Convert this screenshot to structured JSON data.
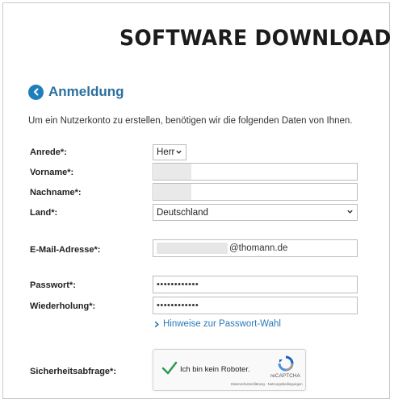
{
  "header": {
    "title": "SOFTWARE DOWNLOAD"
  },
  "section": {
    "title": "Anmeldung",
    "intro": "Um ein Nutzerkonto zu erstellen, benötigen wir die folgenden Daten von Ihnen."
  },
  "form": {
    "salutation": {
      "label": "Anrede*:",
      "value": "Herr"
    },
    "firstname": {
      "label": "Vorname*:",
      "value": ""
    },
    "lastname": {
      "label": "Nachname*:",
      "value": ""
    },
    "country": {
      "label": "Land*:",
      "value": "Deutschland"
    },
    "email": {
      "label": "E-Mail-Adresse*:",
      "domain": "@thomann.de"
    },
    "password": {
      "label": "Passwort*:",
      "value": "••••••••••••"
    },
    "repeat": {
      "label": "Wiederholung*:",
      "value": "••••••••••••"
    },
    "password_hint": "Hinweise zur Passwort-Wahl",
    "security": {
      "label": "Sicherheitsabfrage*:"
    }
  },
  "captcha": {
    "label": "Ich bin kein Roboter.",
    "brand": "reCAPTCHA",
    "legal": "Datenschutzerklärung - Nutzungsbedingungen",
    "check_color": "#2e9c4f"
  },
  "colors": {
    "accent": "#1f7fbd",
    "link": "#2a7ab8"
  }
}
